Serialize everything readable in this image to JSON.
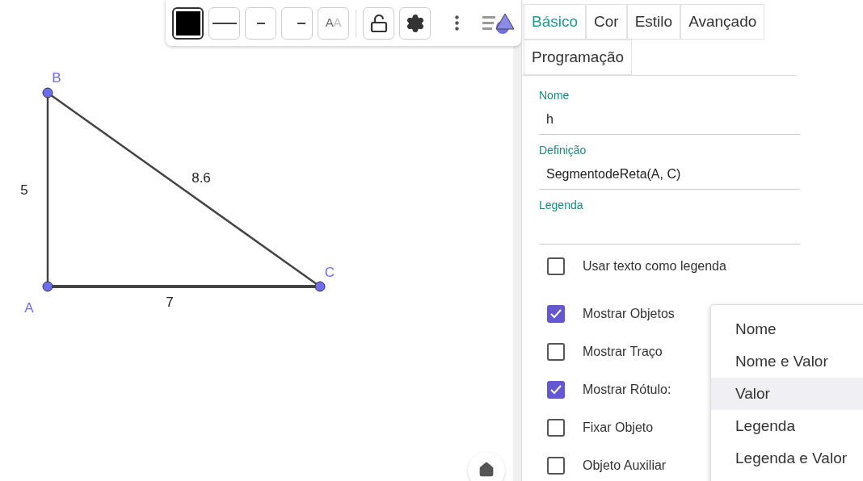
{
  "toolbar": {
    "buttons": [
      {
        "kind": "color",
        "selected": true
      },
      {
        "kind": "line",
        "selected": false
      },
      {
        "kind": "point",
        "selected": false
      },
      {
        "kind": "dash",
        "selected": false
      },
      {
        "kind": "text",
        "label": "AA",
        "selected": false
      },
      {
        "kind": "lock",
        "selected": false
      },
      {
        "kind": "settings",
        "selected": false
      },
      {
        "kind": "more",
        "selected": false
      },
      {
        "kind": "style-bar",
        "selected": false
      }
    ]
  },
  "canvas": {
    "points": [
      {
        "name": "B"
      },
      {
        "name": "A"
      },
      {
        "name": "C"
      }
    ],
    "segments": [
      {
        "label": "5"
      },
      {
        "label": "7"
      },
      {
        "label": "8.6"
      }
    ]
  },
  "panel": {
    "tabs": [
      {
        "label": "Básico",
        "selected": true
      },
      {
        "label": "Cor",
        "selected": false
      },
      {
        "label": "Estilo",
        "selected": false
      },
      {
        "label": "Avançado",
        "selected": false
      },
      {
        "label": "Programação",
        "selected": false
      }
    ],
    "fields": [
      {
        "label": "Nome",
        "value": "h"
      },
      {
        "label": "Definição",
        "value": "SegmentodeReta(A, C)"
      },
      {
        "label": "Legenda"
      }
    ],
    "checkboxes": [
      {
        "label": "Usar texto como legenda",
        "checked": false
      },
      {
        "label": "Mostrar Objetos",
        "checked": true
      },
      {
        "label": "Mostrar Traço",
        "checked": false
      },
      {
        "label": "Mostrar Rótulo:",
        "checked": true
      },
      {
        "label": "Fixar Objeto",
        "checked": false
      },
      {
        "label": "Objeto Auxiliar",
        "checked": false
      }
    ],
    "dropdown": [
      {
        "label": "Nome",
        "selected": false
      },
      {
        "label": "Nome e Valor",
        "selected": false
      },
      {
        "label": "Valor",
        "selected": true
      },
      {
        "label": "Legenda",
        "selected": false
      },
      {
        "label": "Legenda e Valor",
        "selected": false
      }
    ]
  }
}
